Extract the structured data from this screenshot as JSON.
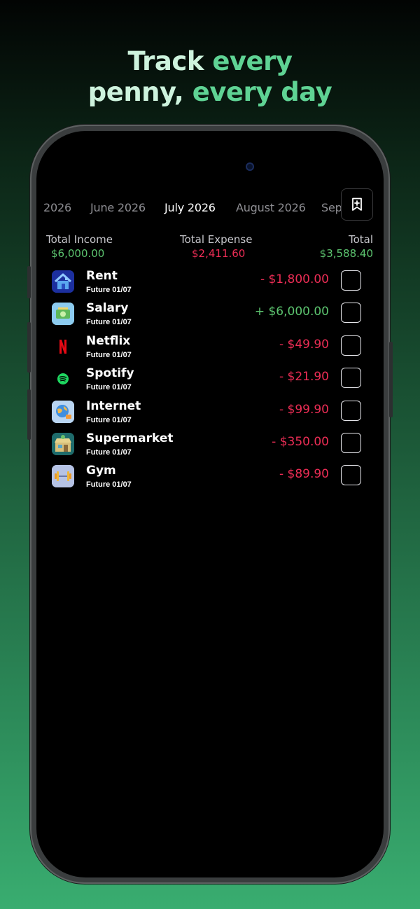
{
  "headline": {
    "line1_a": "Track ",
    "line1_b": "every",
    "line2_a": "penny, ",
    "line2_b": "every",
    "line2_c": " day"
  },
  "months": [
    "2026",
    "June 2026",
    "July 2026",
    "August 2026",
    "Sep"
  ],
  "active_month": "July 2026",
  "bookmark_icon": "bookmark-plus-icon",
  "totals": {
    "income_label": "Total Income",
    "income_value": "$6,000.00",
    "expense_label": "Total Expense",
    "expense_value": "$2,411.60",
    "total_label": "Total",
    "total_value": "$3,588.40"
  },
  "transactions": [
    {
      "name": "Rent",
      "sub": "Future 01/07",
      "amount": "- $1,800.00",
      "kind": "expense",
      "icon": "house-icon"
    },
    {
      "name": "Salary",
      "sub": "Future 01/07",
      "amount": "+ $6,000.00",
      "kind": "income",
      "icon": "money-icon"
    },
    {
      "name": "Netflix",
      "sub": "Future 01/07",
      "amount": "- $49.90",
      "kind": "expense",
      "icon": "netflix-icon"
    },
    {
      "name": "Spotify",
      "sub": "Future 01/07",
      "amount": "- $21.90",
      "kind": "expense",
      "icon": "spotify-icon"
    },
    {
      "name": "Internet",
      "sub": "Future 01/07",
      "amount": "- $99.90",
      "kind": "expense",
      "icon": "globe-icon"
    },
    {
      "name": "Supermarket",
      "sub": "Future 01/07",
      "amount": "- $350.00",
      "kind": "expense",
      "icon": "store-icon"
    },
    {
      "name": "Gym",
      "sub": "Future 01/07",
      "amount": "- $89.90",
      "kind": "expense",
      "icon": "dumbbell-icon"
    }
  ],
  "colors": {
    "income": "#5cc46f",
    "expense": "#ec2d55",
    "muted": "#8e8e93",
    "headline_accent": "#5fd394"
  }
}
